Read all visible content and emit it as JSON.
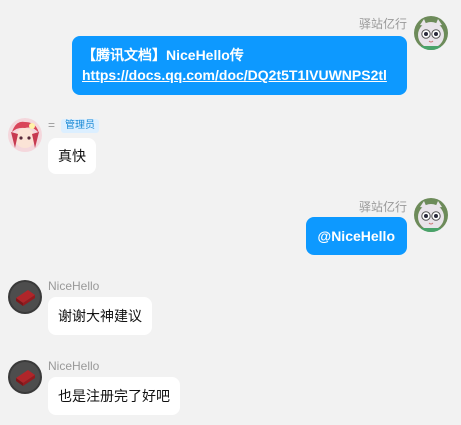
{
  "messages": [
    {
      "sender": "驿站亿行",
      "line1": "【腾讯文档】NiceHello传",
      "line2": "https://docs.qq.com/doc/DQ2t5T1lVUWNPS2tl"
    },
    {
      "sender": "=",
      "role_badge": "管理员",
      "text": "真快"
    },
    {
      "sender": "驿站亿行",
      "text": "@NiceHello"
    },
    {
      "sender": "NiceHello",
      "text": "谢谢大神建议"
    },
    {
      "sender": "NiceHello",
      "text": "也是注册完了好吧"
    }
  ]
}
